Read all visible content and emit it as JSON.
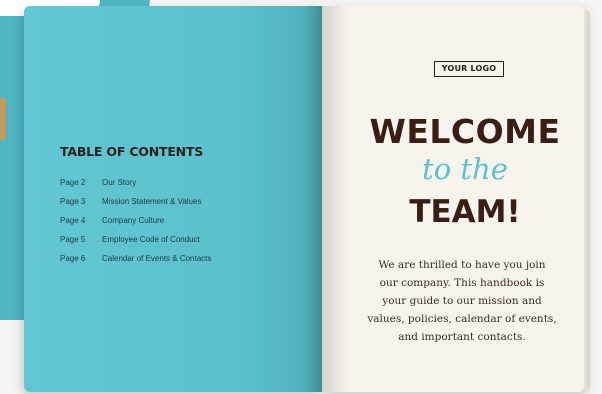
{
  "toc": {
    "title": "TABLE OF CONTENTS",
    "entries": [
      {
        "page": "Page 2",
        "label": "Our Story"
      },
      {
        "page": "Page 3",
        "label": "Mission Statement & Values"
      },
      {
        "page": "Page 4",
        "label": "Company Culture"
      },
      {
        "page": "Page 5",
        "label": "Employee Code of Conduct"
      },
      {
        "page": "Page 6",
        "label": "Calendar of Events & Contacts"
      }
    ]
  },
  "cover": {
    "logo_text": "YOUR LOGO",
    "headline_1": "WELCOME",
    "headline_2": "to the",
    "headline_3": "TEAM!",
    "body_lines": [
      "We are thrilled to have you join",
      "our company. This handbook is",
      "your guide to our mission and",
      "values, policies, calendar of events,",
      "and important contacts."
    ]
  },
  "colors": {
    "teal": "#5cc1cd",
    "brown": "#3a1e16",
    "paper": "#f7f4ee"
  }
}
